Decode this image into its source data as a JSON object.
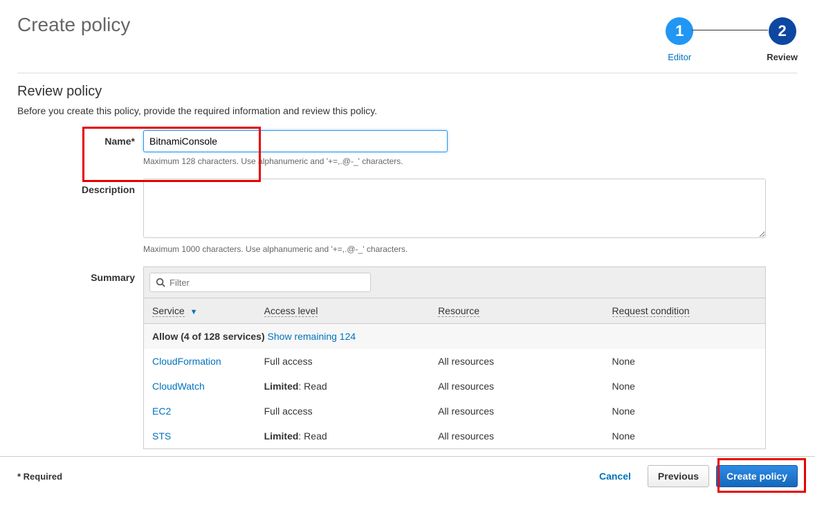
{
  "header": {
    "title": "Create policy",
    "steps": [
      {
        "num": "1",
        "label": "Editor"
      },
      {
        "num": "2",
        "label": "Review"
      }
    ]
  },
  "review": {
    "title": "Review policy",
    "description": "Before you create this policy, provide the required information and review this policy."
  },
  "form": {
    "name_label": "Name*",
    "name_value": "BitnamiConsole",
    "name_helper": "Maximum 128 characters. Use alphanumeric and '+=,.@-_' characters.",
    "desc_label": "Description",
    "desc_value": "",
    "desc_helper": "Maximum 1000 characters. Use alphanumeric and '+=,.@-_' characters.",
    "summary_label": "Summary"
  },
  "filter": {
    "placeholder": "Filter"
  },
  "table": {
    "headers": {
      "service": "Service",
      "access": "Access level",
      "resource": "Resource",
      "request": "Request condition"
    },
    "group": {
      "label": "Allow (4 of 128 services)",
      "link": "Show remaining 124"
    },
    "rows": [
      {
        "service": "CloudFormation",
        "access": "Full access",
        "access_bold": "",
        "resource": "All resources",
        "request": "None"
      },
      {
        "service": "CloudWatch",
        "access": ": Read",
        "access_bold": "Limited",
        "resource": "All resources",
        "request": "None"
      },
      {
        "service": "EC2",
        "access": "Full access",
        "access_bold": "",
        "resource": "All resources",
        "request": "None"
      },
      {
        "service": "STS",
        "access": ": Read",
        "access_bold": "Limited",
        "resource": "All resources",
        "request": "None"
      }
    ]
  },
  "footer": {
    "required": "* Required",
    "cancel": "Cancel",
    "previous": "Previous",
    "create": "Create policy"
  }
}
